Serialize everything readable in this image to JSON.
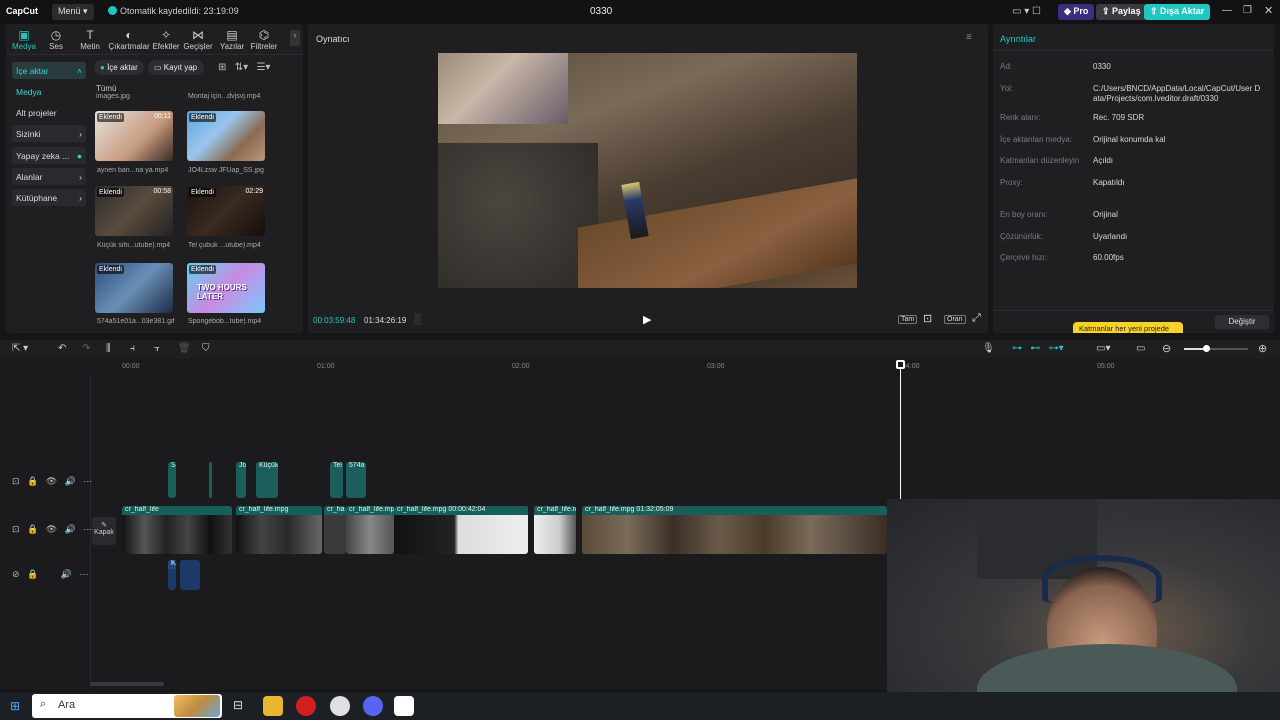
{
  "titlebar": {
    "logo": "CapCut",
    "menu_label": "Menü",
    "autosave": "Otomatik kaydedildi: 23:19:09",
    "project": "0330",
    "pro_label": "Pro",
    "share_label": "Paylaş",
    "export_label": "Dışa Aktar"
  },
  "tabs": [
    {
      "label": "Medya",
      "icon": "media-icon"
    },
    {
      "label": "Ses",
      "icon": "audio-icon"
    },
    {
      "label": "Metin",
      "icon": "text-icon"
    },
    {
      "label": "Çıkartmalar",
      "icon": "sticker-icon"
    },
    {
      "label": "Efektler",
      "icon": "effects-icon"
    },
    {
      "label": "Geçişler",
      "icon": "transition-icon"
    },
    {
      "label": "Yazılar",
      "icon": "captions-icon"
    },
    {
      "label": "Filtreler",
      "icon": "filter-icon"
    }
  ],
  "sidebar": {
    "items": [
      "İçe aktar",
      "Medya",
      "Alt projeler",
      "Sizinki",
      "Yapay zeka ...",
      "Alanlar",
      "Kütüphane"
    ]
  },
  "media": {
    "import_label": "İçe aktar",
    "record_label": "Kayıt yap",
    "all_label": "Tümü",
    "top_files": [
      "images.jpg",
      "Montaj için...dvjsvj.mp4"
    ],
    "items": [
      {
        "tag": "Eklendi",
        "duration": "00:11",
        "caption": "aynen ban...na ya.mp4"
      },
      {
        "tag": "Eklendi",
        "duration": "",
        "caption": "JO4Lzsw JFUap_SS.jpg"
      },
      {
        "tag": "Eklendi",
        "duration": "00:58",
        "caption": "Küçük sihi...utube).mp4"
      },
      {
        "tag": "Eklendi",
        "duration": "02:29",
        "caption": "Tel çubuk ...utube).mp4"
      },
      {
        "tag": "Eklendi",
        "duration": "",
        "caption": "574a51e01a...03e381.gif"
      },
      {
        "tag": "Eklendi",
        "duration": "",
        "caption": "Spongebob...tube).mp4"
      }
    ],
    "overlay_text": "TWO HOURS LATER"
  },
  "player": {
    "title": "Oynatıcı",
    "current_time": "00:03:59:48",
    "total_time": "01:34:26:19",
    "full_label": "Tam",
    "ratio_label": "Oran"
  },
  "details": {
    "title": "Ayrıntılar",
    "rows": [
      {
        "label": "Ad:",
        "value": "0330"
      },
      {
        "label": "Yol:",
        "value": "C:/Users/BNCD/AppData/Local/CapCut/User Data/Projects/com.lveditor.draft/0330"
      },
      {
        "label": "Renk alanı:",
        "value": "Rec. 709 SDR"
      },
      {
        "label": "İçe aktarılan medya:",
        "value": "Orijinal konumda kal"
      },
      {
        "label": "Katmanları düzenleyin",
        "value": "Açıldı"
      },
      {
        "label": "Proxy:",
        "value": "Kapatıldı"
      },
      {
        "label": "En boy oranı:",
        "value": "Orijinal"
      },
      {
        "label": "Çözünürlük:",
        "value": "Uyarlandı"
      },
      {
        "label": "Çerçeve hızı:",
        "value": "60.00fps"
      }
    ],
    "tooltip": "Katmanlar her yeni projede",
    "change_label": "Değiştir"
  },
  "timeline": {
    "ruler": [
      "00:00",
      "01:00",
      "02:00",
      "03:00",
      "04:00",
      "05:00"
    ],
    "cover_label": "Kapak",
    "overlay_clips": [
      "S",
      "Jö",
      "Küçük",
      "Tel",
      "574a"
    ],
    "main_clips": [
      "cr_half_life",
      "cr_half_life.mpg",
      "cr_ha",
      "cr_half_life.mpg",
      "cr_half_life.mpg  00:00:42:04",
      "cr_half_life.m",
      "cr_half_life.mpg  01:32:05:09"
    ],
    "audio_label": "Ki"
  },
  "taskbar": {
    "search_label": "Ara"
  }
}
